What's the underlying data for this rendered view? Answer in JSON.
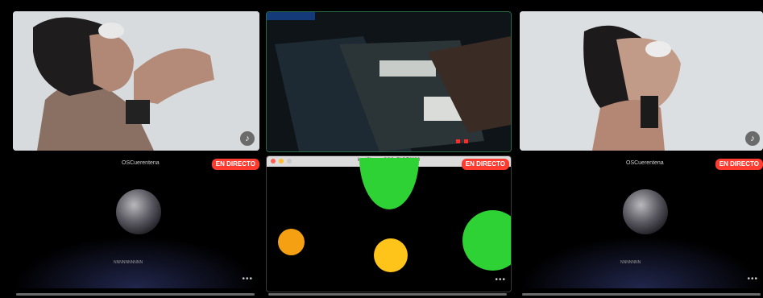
{
  "live_label": "EN DIRECTO",
  "more_label": "•••",
  "mic_icon": "mic-off-icon",
  "tiles": {
    "left_bottom": {
      "name": "OSCuerentena",
      "caption": "NNNNNNNNNN"
    },
    "center_bottom": {
      "window_title": "loadShape_OSC_FADE2030"
    },
    "right_bottom": {
      "name": "OSCuerentena",
      "caption": "NNNNNNN"
    }
  },
  "colors": {
    "live": "#ff3b30",
    "green": "#2fd234",
    "orange": "#f5a013",
    "yellow": "#ffc419"
  }
}
